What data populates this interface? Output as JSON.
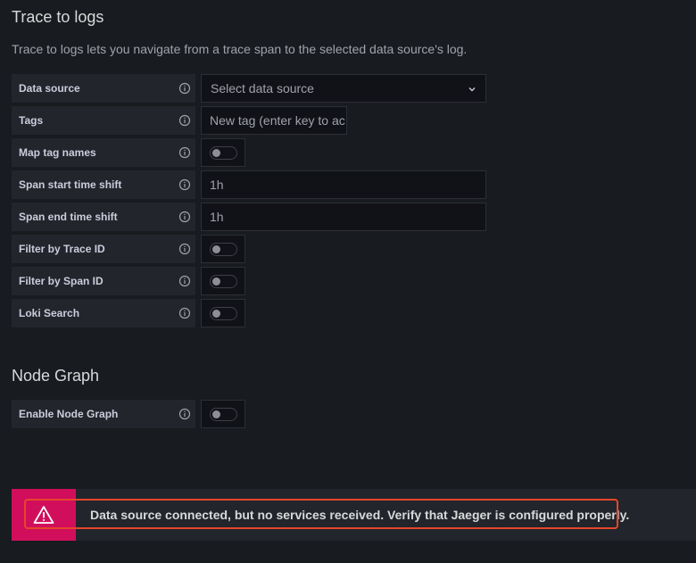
{
  "trace_to_logs": {
    "title": "Trace to logs",
    "description": "Trace to logs lets you navigate from a trace span to the selected data source's log.",
    "data_source": {
      "label": "Data source",
      "placeholder": "Select data source"
    },
    "tags": {
      "label": "Tags",
      "placeholder": "New tag (enter key to ac"
    },
    "map_tag_names": {
      "label": "Map tag names",
      "enabled": false
    },
    "span_start_time_shift": {
      "label": "Span start time shift",
      "placeholder": "1h"
    },
    "span_end_time_shift": {
      "label": "Span end time shift",
      "placeholder": "1h"
    },
    "filter_by_trace_id": {
      "label": "Filter by Trace ID",
      "enabled": false
    },
    "filter_by_span_id": {
      "label": "Filter by Span ID",
      "enabled": false
    },
    "loki_search": {
      "label": "Loki Search",
      "enabled": false
    }
  },
  "node_graph": {
    "title": "Node Graph",
    "enable_node_graph": {
      "label": "Enable Node Graph",
      "enabled": false
    }
  },
  "alert": {
    "message": "Data source connected, but no services received. Verify that Jaeger is configured properly.",
    "icon": "warning-triangle-icon",
    "accent_color": "#d10e5c",
    "highlight_color": "#e5462c"
  },
  "icons": {
    "info": "info-circle-icon",
    "chevron": "chevron-down-icon"
  }
}
